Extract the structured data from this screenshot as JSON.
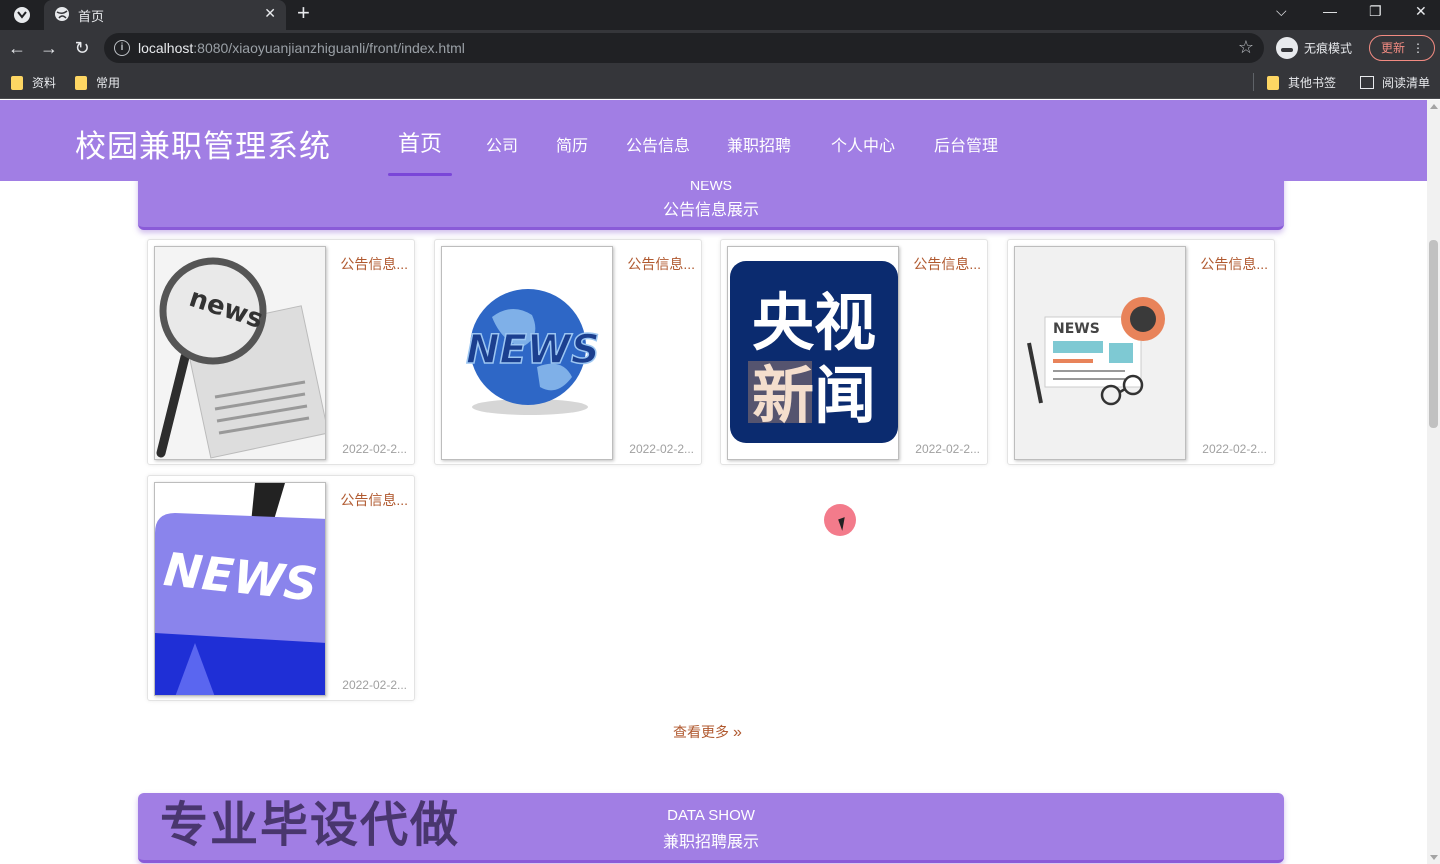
{
  "browser": {
    "tab_title": "首页",
    "url_host": "localhost",
    "url_rest": ":8080/xiaoyuanjianzhiguanli/front/index.html",
    "incognito_label": "无痕模式",
    "update_label": "更新",
    "bookmarks": [
      "资料",
      "常用"
    ],
    "other_bookmarks": "其他书签",
    "reading_list": "阅读清单"
  },
  "site": {
    "title": "校园兼职管理系统",
    "menu": [
      "首页",
      "公司",
      "简历",
      "公告信息",
      "兼职招聘",
      "个人中心",
      "后台管理"
    ],
    "active_menu": "首页"
  },
  "news_section": {
    "en": "NEWS",
    "cn": "公告信息展示",
    "cards": [
      {
        "label": "公告信息...",
        "date": "2022-02-2...",
        "image": "magnifier-news-icon"
      },
      {
        "label": "公告信息...",
        "date": "2022-02-2...",
        "image": "globe-news-icon"
      },
      {
        "label": "公告信息...",
        "date": "2022-02-2...",
        "image": "cctv-news-logo",
        "logo_text": [
          "央视",
          "新闻"
        ]
      },
      {
        "label": "公告信息...",
        "date": "2022-02-2...",
        "image": "newspaper-glasses-icon",
        "logo_text": [
          "NEWS"
        ]
      },
      {
        "label": "公告信息...",
        "date": "2022-02-2...",
        "image": "news-key-icon",
        "logo_text": [
          "NEWS"
        ]
      }
    ],
    "more_label": "查看更多"
  },
  "data_section": {
    "en": "DATA SHOW",
    "cn": "兼职招聘展示",
    "watermark": "专业毕设代做"
  }
}
